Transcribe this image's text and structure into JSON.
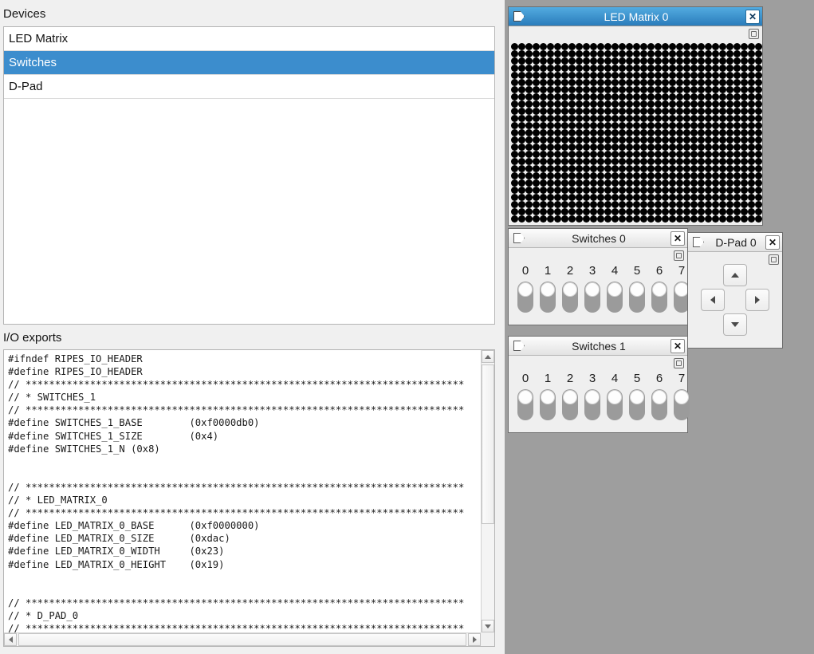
{
  "left_panel": {
    "devices_label": "Devices",
    "devices": [
      {
        "label": "LED Matrix",
        "selected": false
      },
      {
        "label": "Switches",
        "selected": true
      },
      {
        "label": "D-Pad",
        "selected": false
      }
    ],
    "io_exports_label": "I/O exports",
    "io_exports_code": "#ifndef RIPES_IO_HEADER\n#define RIPES_IO_HEADER\n// ***************************************************************************\n// * SWITCHES_1\n// ***************************************************************************\n#define SWITCHES_1_BASE        (0xf0000db0)\n#define SWITCHES_1_SIZE        (0x4)\n#define SWITCHES_1_N (0x8)\n\n\n// ***************************************************************************\n// * LED_MATRIX_0\n// ***************************************************************************\n#define LED_MATRIX_0_BASE      (0xf0000000)\n#define LED_MATRIX_0_SIZE      (0xdac)\n#define LED_MATRIX_0_WIDTH     (0x23)\n#define LED_MATRIX_0_HEIGHT    (0x19)\n\n\n// ***************************************************************************\n// * D_PAD_0\n// ***************************************************************************"
  },
  "windows": {
    "led_matrix": {
      "title": "LED Matrix 0",
      "active": true,
      "close_label": "✕",
      "cols": 35,
      "rows": 25,
      "led_color": "#000000"
    },
    "switches_0": {
      "title": "Switches 0",
      "active": false,
      "close_label": "✕",
      "numbers": [
        "0",
        "1",
        "2",
        "3",
        "4",
        "5",
        "6",
        "7"
      ],
      "states": [
        false,
        false,
        false,
        false,
        false,
        false,
        false,
        false
      ]
    },
    "switches_1": {
      "title": "Switches 1",
      "active": false,
      "close_label": "✕",
      "numbers": [
        "0",
        "1",
        "2",
        "3",
        "4",
        "5",
        "6",
        "7"
      ],
      "states": [
        false,
        false,
        false,
        false,
        false,
        false,
        false,
        false
      ]
    },
    "d_pad": {
      "title": "D-Pad 0",
      "active": false,
      "close_label": "✕",
      "buttons": [
        "up",
        "left",
        "right",
        "down"
      ]
    }
  },
  "colors": {
    "selection_blue": "#3c8dcd",
    "titlebar_active_top": "#53abe0",
    "titlebar_active_bottom": "#2a7cbb",
    "mdi_background": "#9e9e9e",
    "panel_background": "#f0f0f0"
  }
}
